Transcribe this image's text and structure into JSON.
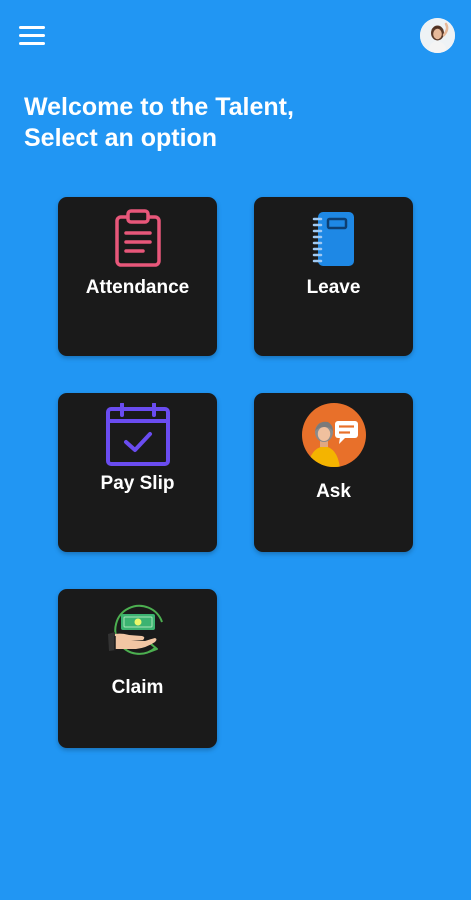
{
  "header": {
    "menu_icon": "hamburger-menu-icon",
    "avatar_icon": "user-avatar"
  },
  "welcome": {
    "line1": "Welcome to the Talent,",
    "line2": "Select an option"
  },
  "options": [
    {
      "label": "Attendance",
      "icon": "clipboard-icon",
      "color": "#E8577A"
    },
    {
      "label": "Leave",
      "icon": "notebook-icon",
      "color": "#1E88E5"
    },
    {
      "label": "Pay Slip",
      "icon": "calendar-check-icon",
      "color": "#6A4CF0"
    },
    {
      "label": "Ask",
      "icon": "person-chat-icon",
      "color": "#E8702A"
    },
    {
      "label": "Claim",
      "icon": "cash-hand-icon",
      "color": "#4CAF50"
    }
  ],
  "colors": {
    "background": "#2196F3",
    "card": "#1A1A1A",
    "text": "#FFFFFF"
  }
}
